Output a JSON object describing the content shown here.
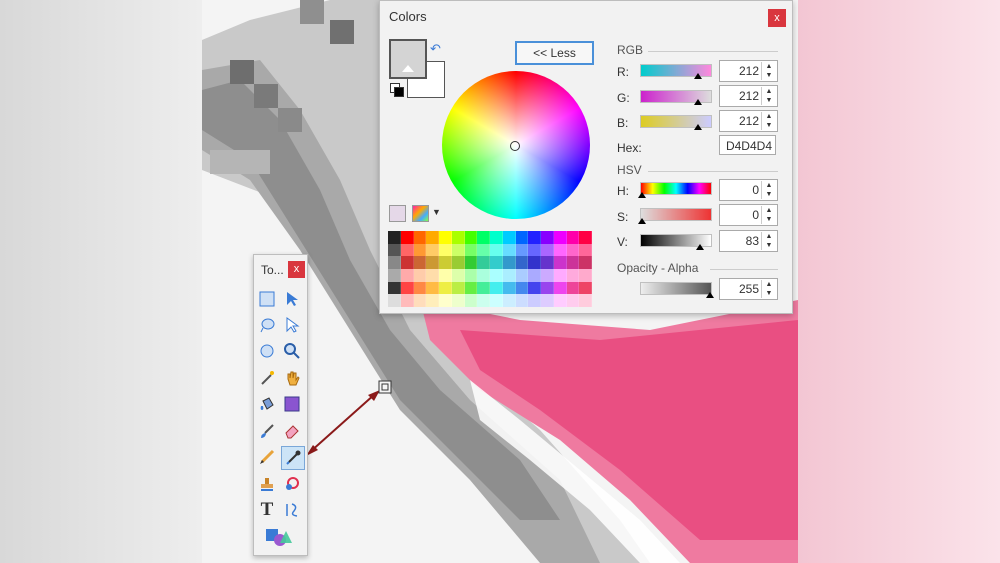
{
  "colors_dialog": {
    "title": "Colors",
    "close_label": "x",
    "less_button": "<< Less",
    "rgb_label": "RGB",
    "hsv_label": "HSV",
    "opacity_label": "Opacity - Alpha",
    "hex_label": "Hex:",
    "hex_value": "D4D4D4",
    "r": {
      "label": "R:",
      "value": "212"
    },
    "g": {
      "label": "G:",
      "value": "212"
    },
    "b": {
      "label": "B:",
      "value": "212"
    },
    "h": {
      "label": "H:",
      "value": "0"
    },
    "s": {
      "label": "S:",
      "value": "0"
    },
    "v": {
      "label": "V:",
      "value": "83"
    },
    "alpha": {
      "value": "255"
    },
    "primary_color": "#D4D4D4",
    "secondary_color": "#FFFFFF"
  },
  "tools_window": {
    "title": "To...",
    "close_label": "x",
    "tools": [
      "rectangle-select-icon",
      "move-selection-icon",
      "lasso-select-icon",
      "move-selected-icon",
      "ellipse-select-icon",
      "zoom-icon",
      "magic-wand-icon",
      "pan-icon",
      "paint-bucket-icon",
      "gradient-icon",
      "paintbrush-icon",
      "eraser-icon",
      "pencil-icon",
      "color-picker-icon",
      "clone-stamp-icon",
      "recolor-icon",
      "text-icon",
      "line-curve-icon",
      "shapes-icon"
    ],
    "active_tool": "color-picker-icon"
  },
  "accent_color": "#4A90D9",
  "arrow_color": "#8B1A1A"
}
